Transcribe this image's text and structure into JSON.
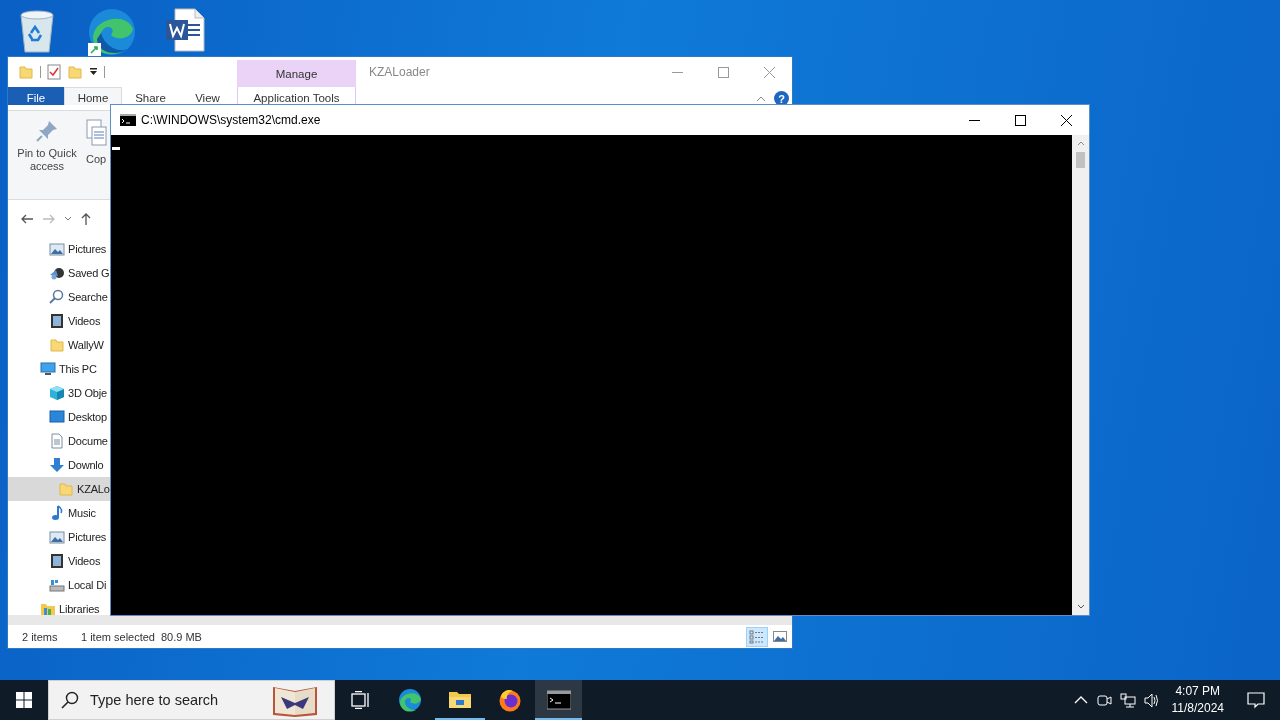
{
  "explorer": {
    "title": "KZALoader",
    "contextual_group": "Manage",
    "tabs": [
      {
        "label": "File",
        "kind": "file",
        "selected": false
      },
      {
        "label": "Home",
        "kind": "plain",
        "selected": true
      },
      {
        "label": "Share",
        "kind": "plain",
        "selected": false
      },
      {
        "label": "View",
        "kind": "plain",
        "selected": false
      },
      {
        "label": "Application Tools",
        "kind": "contextual",
        "selected": false
      }
    ],
    "help_button": "?",
    "ribbon_commands": [
      {
        "label": "Pin to Quick access",
        "kind": "pin"
      },
      {
        "label": "Cop",
        "kind": "copy"
      }
    ],
    "nav_tree": [
      {
        "children": [
          {
            "label": "Pictures",
            "kind": "pictures",
            "selected": false
          },
          {
            "label": "Saved G",
            "kind": "saved-games",
            "selected": false
          },
          {
            "label": "Searche",
            "kind": "search",
            "selected": false
          },
          {
            "label": "Videos",
            "kind": "videos",
            "selected": false
          },
          {
            "label": "WallyW",
            "kind": "folder",
            "selected": false
          }
        ]
      },
      {
        "label": "This PC",
        "kind": "pc",
        "selected": false,
        "children": [
          {
            "label": "3D Obje",
            "kind": "cube",
            "selected": false
          },
          {
            "label": "Desktop",
            "kind": "desktop",
            "selected": false
          },
          {
            "label": "Docume",
            "kind": "documents",
            "selected": false
          },
          {
            "label": "Downlo",
            "kind": "downloads",
            "selected": false,
            "children": [
              {
                "label": "KZALo",
                "kind": "folder",
                "selected": true
              }
            ]
          },
          {
            "label": "Music",
            "kind": "music",
            "selected": false
          },
          {
            "label": "Pictures",
            "kind": "pictures",
            "selected": false
          },
          {
            "label": "Videos",
            "kind": "videos",
            "selected": false
          },
          {
            "label": "Local Di",
            "kind": "drive",
            "selected": false
          }
        ]
      },
      {
        "label": "Libraries",
        "kind": "libraries",
        "selected": false
      }
    ],
    "status_bar": {
      "item_count": "2 items",
      "selection": "1 item selected",
      "size": "80.9 MB"
    },
    "view_buttons": [
      {
        "kind": "details",
        "selected": true
      },
      {
        "kind": "large-icons",
        "selected": false
      }
    ]
  },
  "cmd": {
    "title": "C:\\WINDOWS\\system32\\cmd.exe"
  },
  "taskbar": {
    "search_placeholder": "Type here to search",
    "apps": [
      {
        "kind": "task-view",
        "running": false,
        "selected": false
      },
      {
        "kind": "edge",
        "running": false,
        "selected": false
      },
      {
        "kind": "explorer",
        "running": true,
        "selected": false
      },
      {
        "kind": "firefox",
        "running": false,
        "selected": false
      },
      {
        "kind": "cmd",
        "running": true,
        "selected": true
      }
    ],
    "clock": {
      "time": "4:07 PM",
      "date": "11/8/2024"
    }
  }
}
